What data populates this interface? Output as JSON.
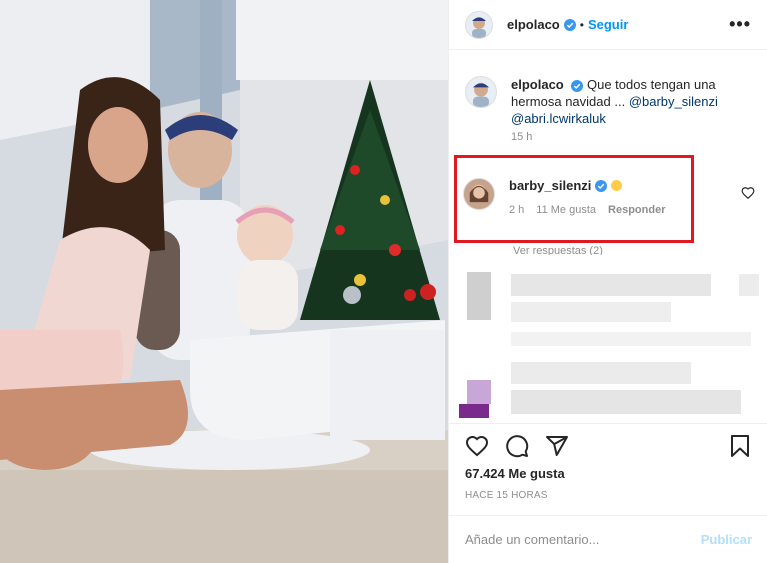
{
  "post": {
    "author": {
      "username": "elpolaco",
      "verified": true,
      "follow_label": "Seguir",
      "more_label": "•••"
    },
    "caption": {
      "username": "elpolaco",
      "text": "Que todos tengan una hermosa navidad ...",
      "mention1": "@barby_silenzi",
      "mention2": "@abri.lcwirkaluk",
      "time": "15 h"
    },
    "highlighted_comment": {
      "username": "barby_silenzi",
      "verified": true,
      "time": "2 h",
      "likes": "11 Me gusta",
      "reply_label": "Responder"
    },
    "replies_label": "Ver respuestas (2)",
    "likes_count": "67.424 Me gusta",
    "posted_ago": "HACE 15 HORAS",
    "comment_box": {
      "placeholder": "Añade un comentario...",
      "publish_label": "Publicar"
    },
    "accent_color": "#0095f6",
    "highlight_color": "#e0191e"
  },
  "icons": {
    "like": "heart-icon",
    "comment": "comment-icon",
    "share": "share-icon",
    "save": "bookmark-icon",
    "comment_like": "heart-icon"
  }
}
